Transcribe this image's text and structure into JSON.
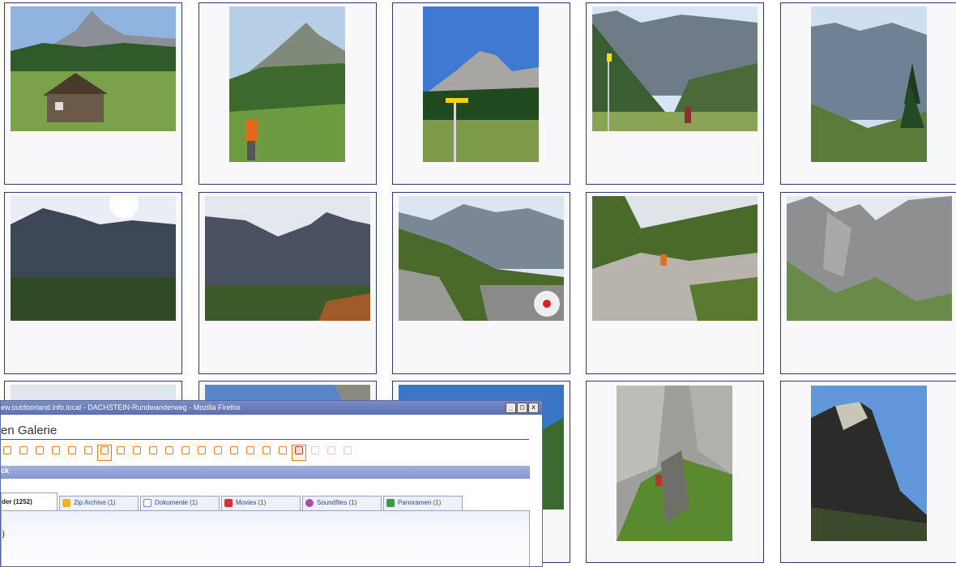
{
  "popup": {
    "title": "ew.outdoorland.info.local - DACHSTEIN-Rundwanderweg - Mozilla Firefox",
    "heading": "en Galerie",
    "bar_label": "ck",
    "panel_text": ")",
    "window_buttons": {
      "minimize": "_",
      "maximize": "□",
      "close": "x"
    },
    "toolbar_labels": [
      "",
      "",
      "",
      "",
      "",
      "",
      "",
      "",
      "",
      "",
      "",
      "",
      "",
      "",
      "",
      "",
      "",
      "",
      "",
      "",
      "",
      ""
    ],
    "tabs": [
      {
        "label": "der (1252)",
        "icon": "folder-icon",
        "color": ""
      },
      {
        "label": "Zip Archive (1)",
        "icon": "zip-icon",
        "color": "#f0b030"
      },
      {
        "label": "Dokumente (1)",
        "icon": "document-icon",
        "color": "#6a8ed8"
      },
      {
        "label": "Movies (1)",
        "icon": "movie-icon",
        "color": "#d83030"
      },
      {
        "label": "Soundfiles (1)",
        "icon": "sound-icon",
        "color": "#b048b0"
      },
      {
        "label": "Panoramen (1)",
        "icon": "panorama-icon",
        "color": "#3a9a4a"
      }
    ]
  },
  "colors": {
    "tile_border": "#2b3a6b",
    "tile_bg": "#f8f8fb",
    "accent_orange": "#f07a18",
    "bar_blue": "#8597cc"
  },
  "gallery": {
    "photos": [
      {
        "subject": "alpine-hut-with-peak",
        "orientation": "landscape"
      },
      {
        "subject": "hiker-below-peak",
        "orientation": "portrait"
      },
      {
        "subject": "yellow-signpost-peak",
        "orientation": "portrait"
      },
      {
        "subject": "valley-signpost-hiker",
        "orientation": "landscape"
      },
      {
        "subject": "forest-valley-cliffs",
        "orientation": "portrait"
      },
      {
        "subject": "sunlit-ridge",
        "orientation": "landscape"
      },
      {
        "subject": "dark-mountain-range",
        "orientation": "landscape"
      },
      {
        "subject": "rocky-slope-trail-mark",
        "orientation": "landscape"
      },
      {
        "subject": "boulder-field-hiker",
        "orientation": "landscape"
      },
      {
        "subject": "grey-limestone-cliffs",
        "orientation": "landscape"
      },
      {
        "subject": "partial-photo",
        "orientation": "landscape"
      },
      {
        "subject": "partial-photo",
        "orientation": "landscape"
      },
      {
        "subject": "partial-photo",
        "orientation": "landscape"
      },
      {
        "subject": "gully-climber",
        "orientation": "portrait"
      },
      {
        "subject": "rock-tower-sky",
        "orientation": "portrait"
      }
    ]
  }
}
